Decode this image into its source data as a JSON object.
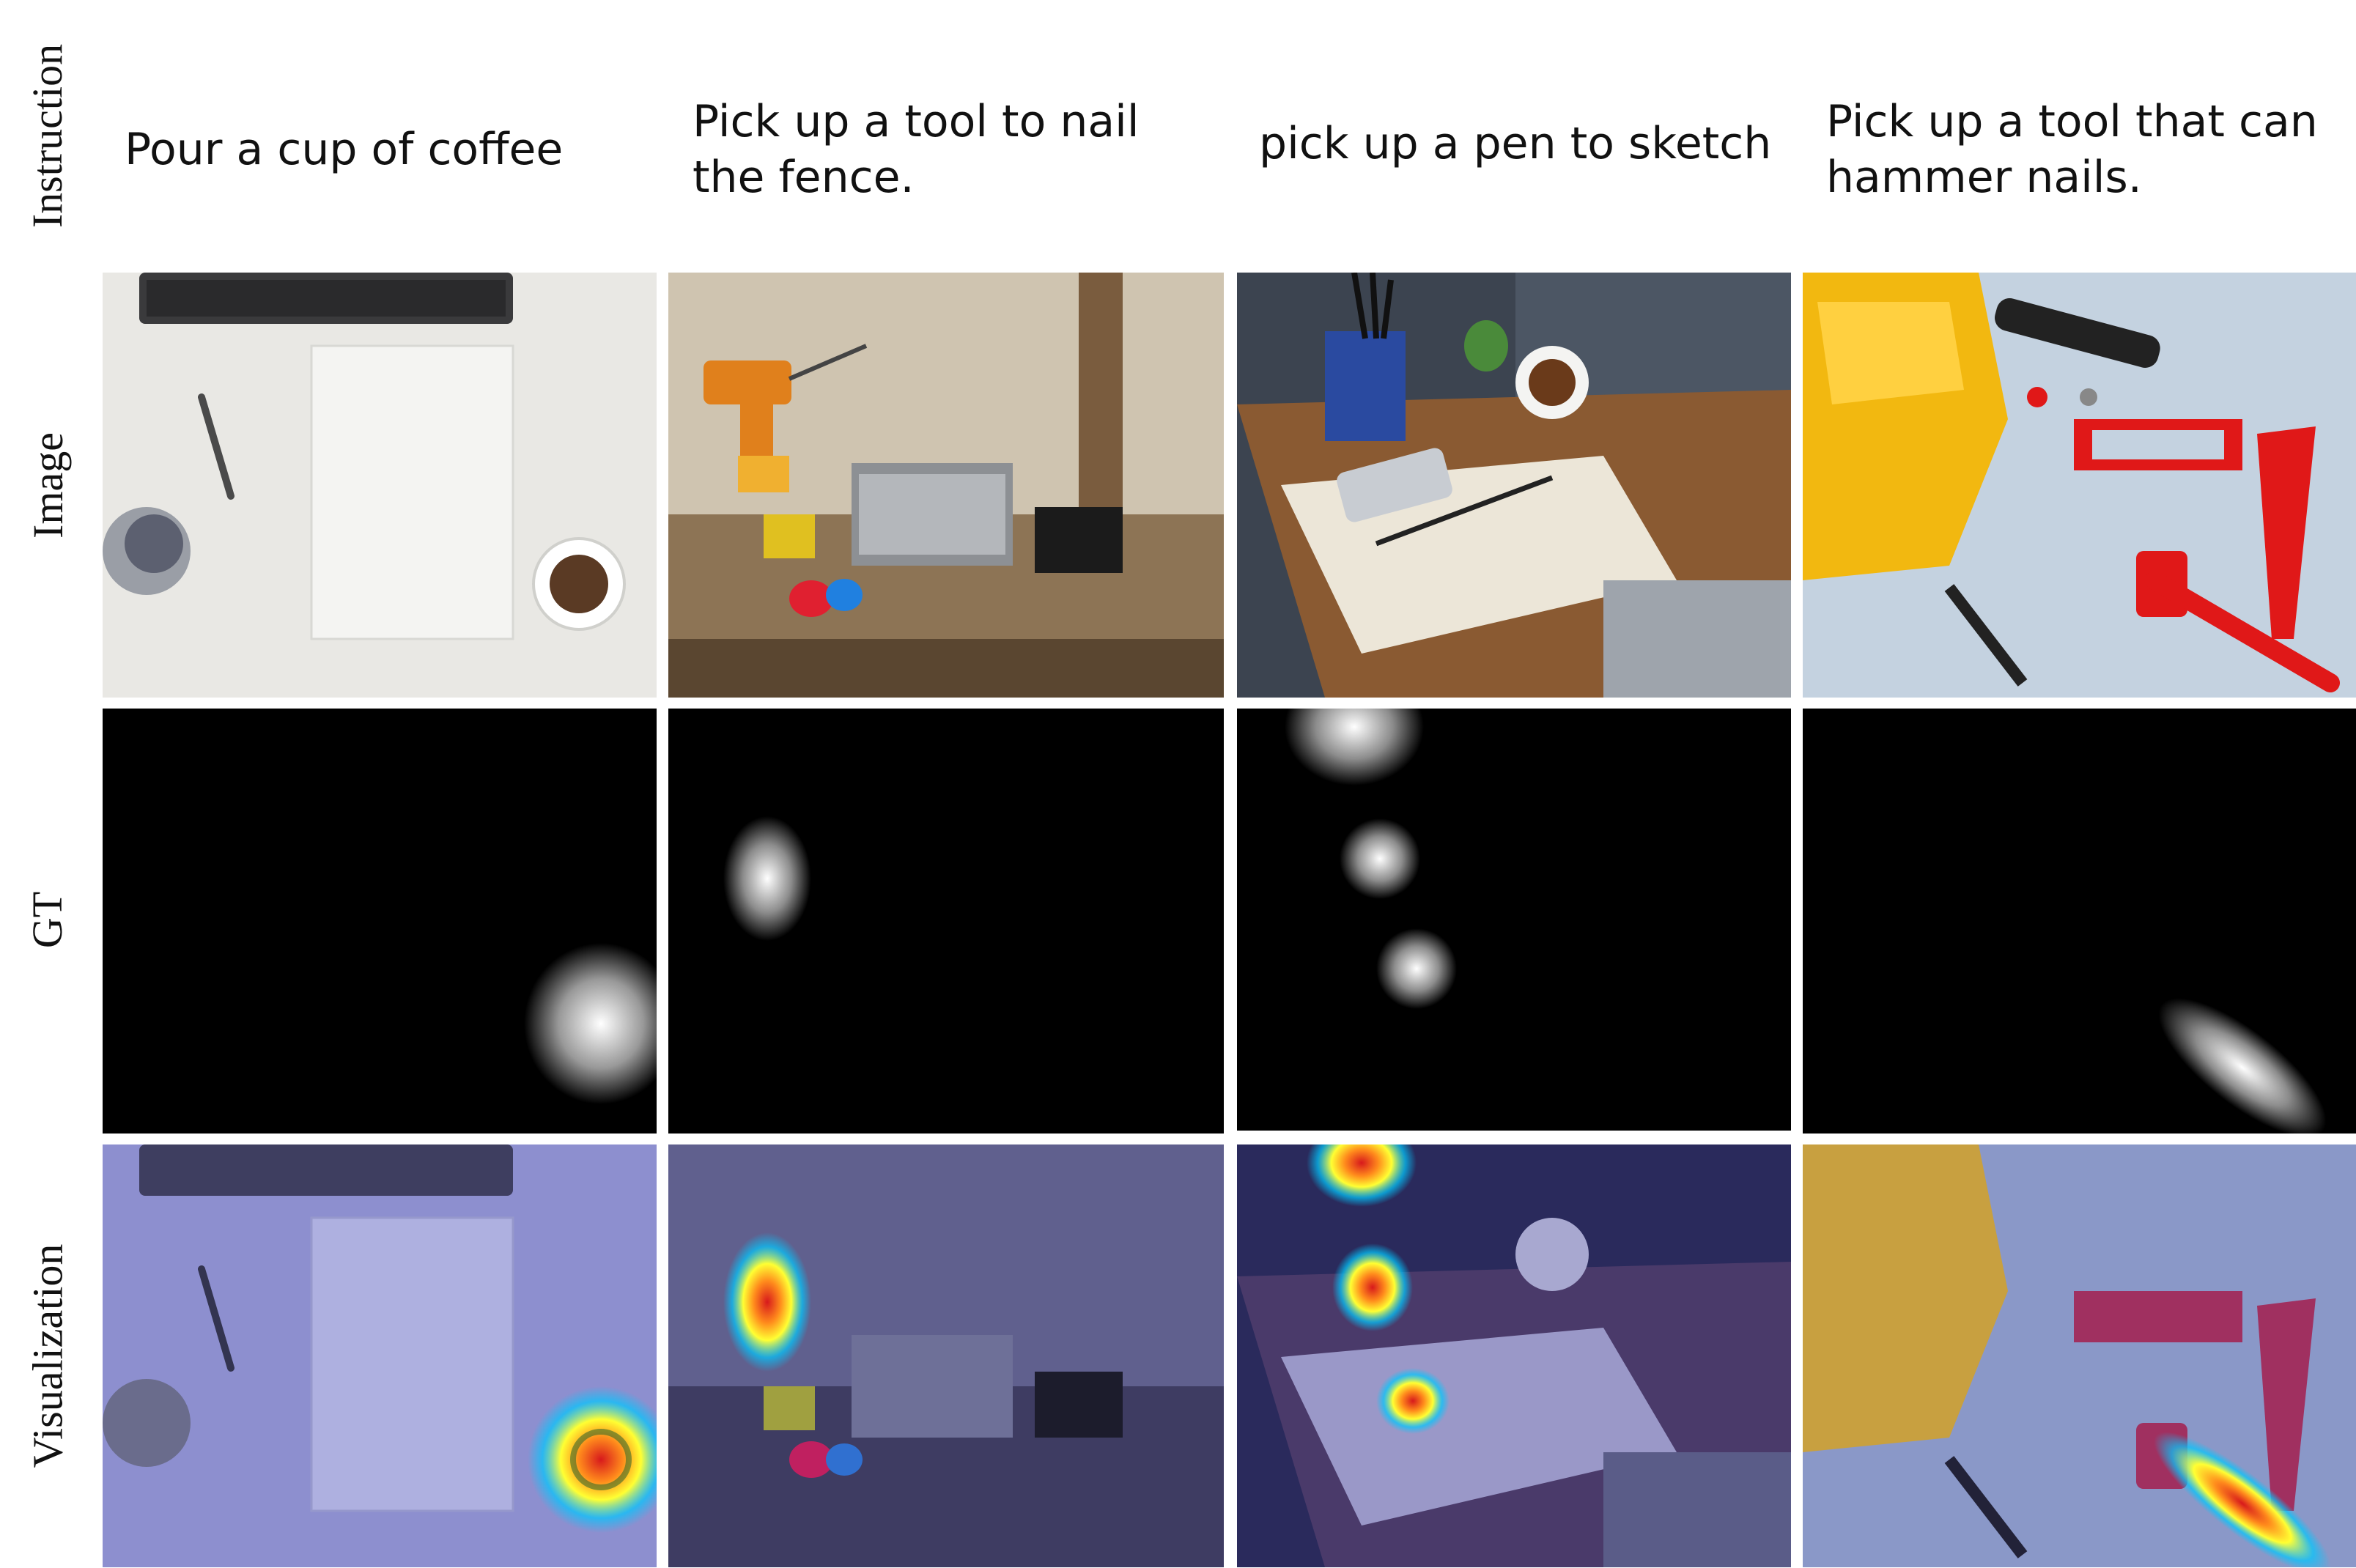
{
  "row_labels": {
    "instruction": "Instruction",
    "image": "Image",
    "gt": "GT",
    "visualization": "Visualization"
  },
  "columns": [
    {
      "instruction": "Pour a cup of coffee"
    },
    {
      "instruction": "Pick up a tool to nail\nthe fence."
    },
    {
      "instruction": "pick up a pen to sketch"
    },
    {
      "instruction": "Pick up a tool that can\nhammer nails."
    }
  ],
  "colors": {
    "background": "#ffffff",
    "gt_background": "#000000",
    "heat_hot": "#d7191c",
    "heat_mid": "#ffff33",
    "heat_cool": "#00c8ff",
    "overlay_tint": "#3c3c9a"
  }
}
